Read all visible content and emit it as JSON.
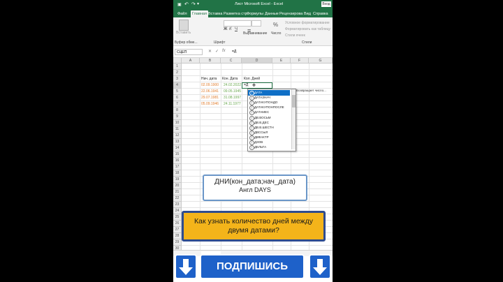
{
  "window": {
    "title": "Лист Microsoft Excel - Excel",
    "signin_label": "Вход"
  },
  "tabs": [
    "Файл",
    "Главная",
    "Вставка",
    "Разметка стр",
    "Формулы",
    "Данные",
    "Рецензирова",
    "Вид",
    "Справка"
  ],
  "active_tab": "Главная",
  "ribbon": {
    "paste": "Вставить",
    "clipboard_group": "Буфер обме...",
    "font_group": "Шрифт",
    "align": "Выравнивание",
    "number": "Число",
    "styles_group": "Стили",
    "cond_format": "Условное форматирование",
    "format_table": "Форматировать как таблицу",
    "cell_styles": "Стили ячеек"
  },
  "formula_bar": {
    "name_box": "СЦЕП",
    "formula": "=Д"
  },
  "columns": [
    "A",
    "B",
    "C",
    "D",
    "E",
    "F",
    "G"
  ],
  "rows": [
    "1",
    "2",
    "3",
    "4",
    "5",
    "6",
    "7",
    "8",
    "9",
    "10",
    "11",
    "12",
    "13",
    "14",
    "15",
    "16",
    "17",
    "18",
    "19",
    "20",
    "21",
    "22",
    "23",
    "24",
    "25",
    "26",
    "27",
    "28",
    "29",
    "30"
  ],
  "table": {
    "header_start": "Нач. дата",
    "header_end": "Кон. Дата",
    "header_days": "Кол. Дней",
    "start_dates": [
      "02.09.1900",
      "22.06.1941",
      "29.07.1981",
      "05.09.1946"
    ],
    "end_dates": [
      "24.02.2022",
      "09.05.1945",
      "31.08.1997",
      "24.11.1977"
    ],
    "active_cell_text": "=Д"
  },
  "autocomplete": {
    "items": [
      "ДАТА",
      "ДАТАЗНАЧ",
      "ДАТАКУПОНДО",
      "ДАТАКУПОНПОСЛЕ",
      "ДАТАМЕС",
      "ДВ.ВОСЬМ",
      "ДВ.В.ДЕС",
      "ДВ.В.ШЕСТН",
      "ДВССЫЛ",
      "ДВФАКТР",
      "ДЗОВ",
      "ДЕЛЬТА"
    ],
    "selected": 0,
    "tooltip": "Возвращает число..."
  },
  "overlay": {
    "formula_line1": "ДНИ(кон_дата;нач_дата)",
    "formula_line2": "Англ DAYS",
    "question": "Как узнать количество дней между двумя датами?",
    "subscribe": "ПОДПИШИСЬ"
  },
  "colors": {
    "excel_green": "#217346",
    "start_date_color": "#e07b2a",
    "end_date_color": "#6aa84f",
    "banner_yellow": "#f4b41a",
    "button_blue": "#1e61c9"
  }
}
